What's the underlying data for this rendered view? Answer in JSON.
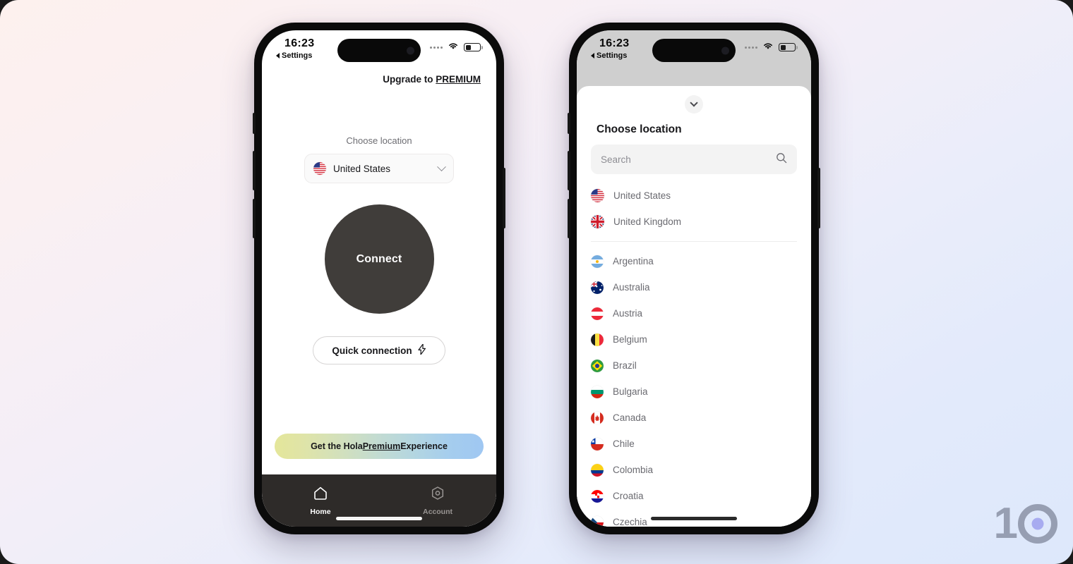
{
  "background": {
    "gradient_start": "#fdf1ee",
    "gradient_end": "#dde8fb"
  },
  "watermark": {
    "digit_one": "1",
    "accent_color": "#7b7ae8",
    "text_color": "#5d6378"
  },
  "status_bar": {
    "time": "16:23",
    "back_label": "Settings",
    "wifi_icon": "wifi-icon",
    "battery_icon": "battery-icon",
    "signal_icon": "signal-dots-icon"
  },
  "home_screen": {
    "upgrade_prefix": "Upgrade to ",
    "upgrade_link": "PREMIUM",
    "choose_location_label": "Choose location",
    "selected_location": "United States",
    "selected_location_flag": "flag-us",
    "chevron_icon": "chevron-down-icon",
    "connect_button": "Connect",
    "connect_button_color": "#403d3a",
    "quick_connection": "Quick connection",
    "quick_connection_icon": "lightning-bolt-icon",
    "promo_prefix": "Get the Hola ",
    "promo_link": "Premium",
    "promo_suffix": " Experience",
    "promo_gradient_start": "#e4e69a",
    "promo_gradient_end": "#9fc7f2",
    "tabs": [
      {
        "label": "Home",
        "icon": "home-icon",
        "active": true
      },
      {
        "label": "Account",
        "icon": "hexagon-gear-icon",
        "active": false
      }
    ]
  },
  "location_sheet": {
    "grabber_icon": "chevron-down-icon",
    "title": "Choose location",
    "search_placeholder": "Search",
    "search_value": "",
    "search_icon": "search-icon",
    "favorites": [
      {
        "name": "United States",
        "flag": "flag-us"
      },
      {
        "name": "United Kingdom",
        "flag": "flag-gb"
      }
    ],
    "countries": [
      {
        "name": "Argentina",
        "flag": "flag-ar"
      },
      {
        "name": "Australia",
        "flag": "flag-au"
      },
      {
        "name": "Austria",
        "flag": "flag-at"
      },
      {
        "name": "Belgium",
        "flag": "flag-be"
      },
      {
        "name": "Brazil",
        "flag": "flag-br"
      },
      {
        "name": "Bulgaria",
        "flag": "flag-bg"
      },
      {
        "name": "Canada",
        "flag": "flag-ca"
      },
      {
        "name": "Chile",
        "flag": "flag-cl"
      },
      {
        "name": "Colombia",
        "flag": "flag-co"
      },
      {
        "name": "Croatia",
        "flag": "flag-hr"
      },
      {
        "name": "Czechia",
        "flag": "flag-cz"
      }
    ]
  }
}
